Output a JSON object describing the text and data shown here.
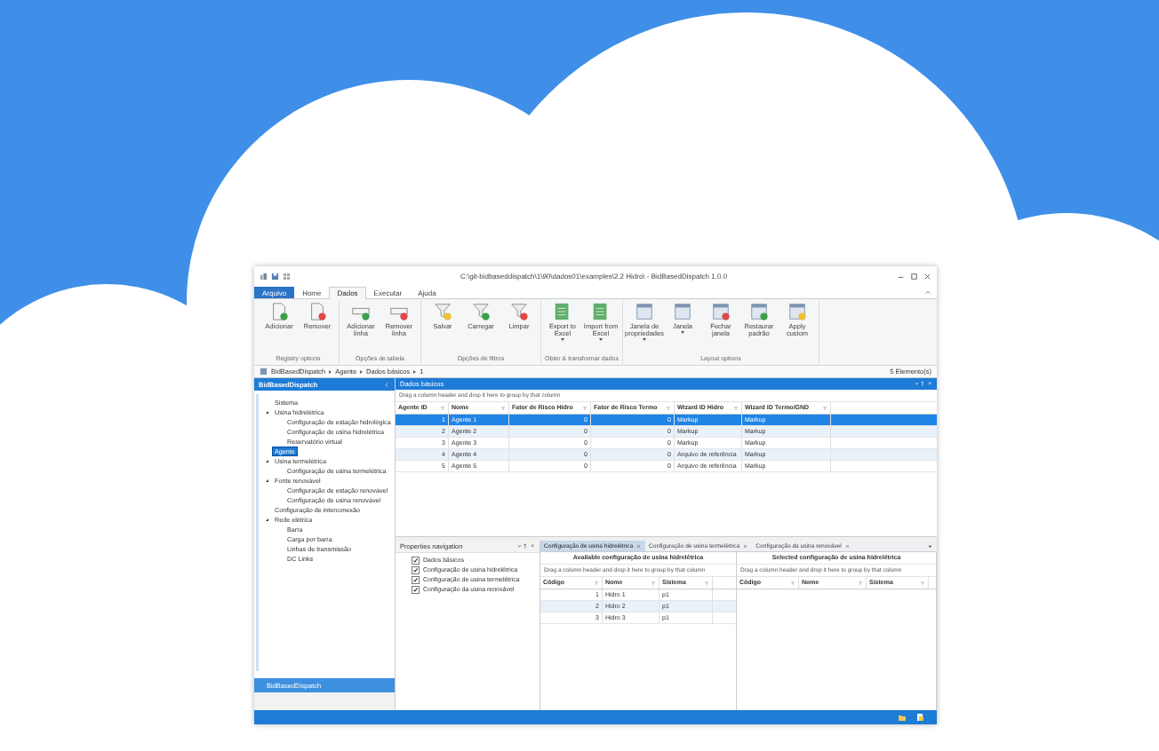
{
  "window": {
    "title": "C:\\git-bidbaseddispatch\\1\\90\\dados01\\examples\\2.2 Hidro\\ - BidBasedDispatch 1.0.0"
  },
  "ribbon": {
    "tabs": [
      {
        "label": "Arquivo",
        "kind": "file",
        "selected": false
      },
      {
        "label": "Home",
        "kind": "tab",
        "selected": false
      },
      {
        "label": "Dados",
        "kind": "tab",
        "selected": true
      },
      {
        "label": "Executar",
        "kind": "tab",
        "selected": false
      },
      {
        "label": "Ajuda",
        "kind": "tab",
        "selected": false
      }
    ],
    "groups": [
      {
        "label": "Registry options",
        "buttons": [
          {
            "label": "Adicionar",
            "dropdown": false
          },
          {
            "label": "Remover",
            "dropdown": false
          }
        ]
      },
      {
        "label": "Opções de tabela",
        "buttons": [
          {
            "label": "Adicionar linha",
            "dropdown": false
          },
          {
            "label": "Remover linha",
            "dropdown": false
          }
        ]
      },
      {
        "label": "Opções de filtros",
        "buttons": [
          {
            "label": "Salvar",
            "dropdown": false
          },
          {
            "label": "Carregar",
            "dropdown": false
          },
          {
            "label": "Limpar",
            "dropdown": false
          }
        ]
      },
      {
        "label": "Obter & transformar dados",
        "buttons": [
          {
            "label": "Export to Excel",
            "dropdown": true
          },
          {
            "label": "Import from Excel",
            "dropdown": true
          }
        ]
      },
      {
        "label": "Layout options",
        "buttons": [
          {
            "label": "Janela de propriedades",
            "dropdown": true
          },
          {
            "label": "Janela",
            "dropdown": true
          },
          {
            "label": "Fechar janela",
            "dropdown": false
          },
          {
            "label": "Restaurar padrão",
            "dropdown": false
          },
          {
            "label": "Apply custom",
            "dropdown": false
          }
        ]
      }
    ]
  },
  "breadcrumb": {
    "items": [
      "BidBasedDispatch",
      "Agente",
      "Dados básicos",
      "1"
    ],
    "count": "5 Elemento(s)"
  },
  "navigator": {
    "title": "BidBasedDispatch",
    "footer": "BidBasedDispatch",
    "tree": [
      {
        "label": "Sistema",
        "selected": false
      },
      {
        "label": "Usina hidrelétrica",
        "selected": false,
        "expanded": true,
        "children": [
          {
            "label": "Configuração de estação hidrológica",
            "selected": false
          },
          {
            "label": "Configuração de usina hidrelétrica",
            "selected": false
          },
          {
            "label": "Reservatório virtual",
            "selected": false
          }
        ]
      },
      {
        "label": "Agente",
        "selected": true
      },
      {
        "label": "Usina termelétrica",
        "selected": false,
        "expanded": true,
        "children": [
          {
            "label": "Configuração de usina termelétrica",
            "selected": false
          }
        ]
      },
      {
        "label": "Fonte renovável",
        "selected": false,
        "expanded": true,
        "children": [
          {
            "label": "Configuração de estação renovável",
            "selected": false
          },
          {
            "label": "Configuração de usina renovável",
            "selected": false
          }
        ]
      },
      {
        "label": "Configuração de interconexão",
        "selected": false
      },
      {
        "label": "Rede elétrica",
        "selected": false,
        "expanded": true,
        "children": [
          {
            "label": "Barra",
            "selected": false
          },
          {
            "label": "Carga por barra",
            "selected": false
          },
          {
            "label": "Linhas de transmissão",
            "selected": false
          },
          {
            "label": "DC Links",
            "selected": false
          }
        ]
      }
    ]
  },
  "data_panel": {
    "title": "Dados básicos",
    "hint": "Drag a column header and drop it here to group by that column",
    "columns": [
      "Agente ID",
      "Nome",
      "Fator de Risco Hidro",
      "Fator de Risco Termo",
      "Wizard ID Hidro",
      "Wizard ID Termo/GND"
    ],
    "rows": [
      {
        "cells": [
          "1",
          "Agente 1",
          "0",
          "0",
          "Markup",
          "Markup"
        ],
        "selected": true
      },
      {
        "cells": [
          "2",
          "Agente 2",
          "0",
          "0",
          "Markup",
          "Markup"
        ],
        "selected": false
      },
      {
        "cells": [
          "3",
          "Agente 3",
          "0",
          "0",
          "Markup",
          "Markup"
        ],
        "selected": false
      },
      {
        "cells": [
          "4",
          "Agente 4",
          "0",
          "0",
          "Arquivo de referência",
          "Markup"
        ],
        "selected": false
      },
      {
        "cells": [
          "5",
          "Agente 5",
          "0",
          "0",
          "Arquivo de referência",
          "Markup"
        ],
        "selected": false
      }
    ]
  },
  "properties": {
    "title": "Properties navigation",
    "items": [
      {
        "label": "Dados básicos",
        "checked": true
      },
      {
        "label": "Configuração de usina hidrelétrica",
        "checked": true
      },
      {
        "label": "Configuração de usina termelétrica",
        "checked": true
      },
      {
        "label": "Configuração da usina renovável",
        "checked": true
      }
    ]
  },
  "config": {
    "tabs": [
      {
        "label": "Configuração de usina hidrelétrica",
        "selected": true
      },
      {
        "label": "Configuração de usina termelétrica",
        "selected": false
      },
      {
        "label": "Configuração da usina renovável",
        "selected": false
      }
    ],
    "panels": [
      {
        "title": "Available configuração de usina hidrelétrica",
        "hint": "Drag a column header and drop it here to group by that column",
        "columns": [
          "Código",
          "Nome",
          "Sistema"
        ],
        "rows": [
          {
            "cells": [
              "1",
              "Hidro 1",
              "p1"
            ]
          },
          {
            "cells": [
              "2",
              "Hidro 2",
              "p1"
            ]
          },
          {
            "cells": [
              "3",
              "Hidro 3",
              "p1"
            ]
          }
        ]
      },
      {
        "title": "Selected configuração de usina hidrelétrica",
        "hint": "Drag a column header and drop it here to group by that column",
        "columns": [
          "Código",
          "Nome",
          "Sistema"
        ]
      }
    ]
  }
}
